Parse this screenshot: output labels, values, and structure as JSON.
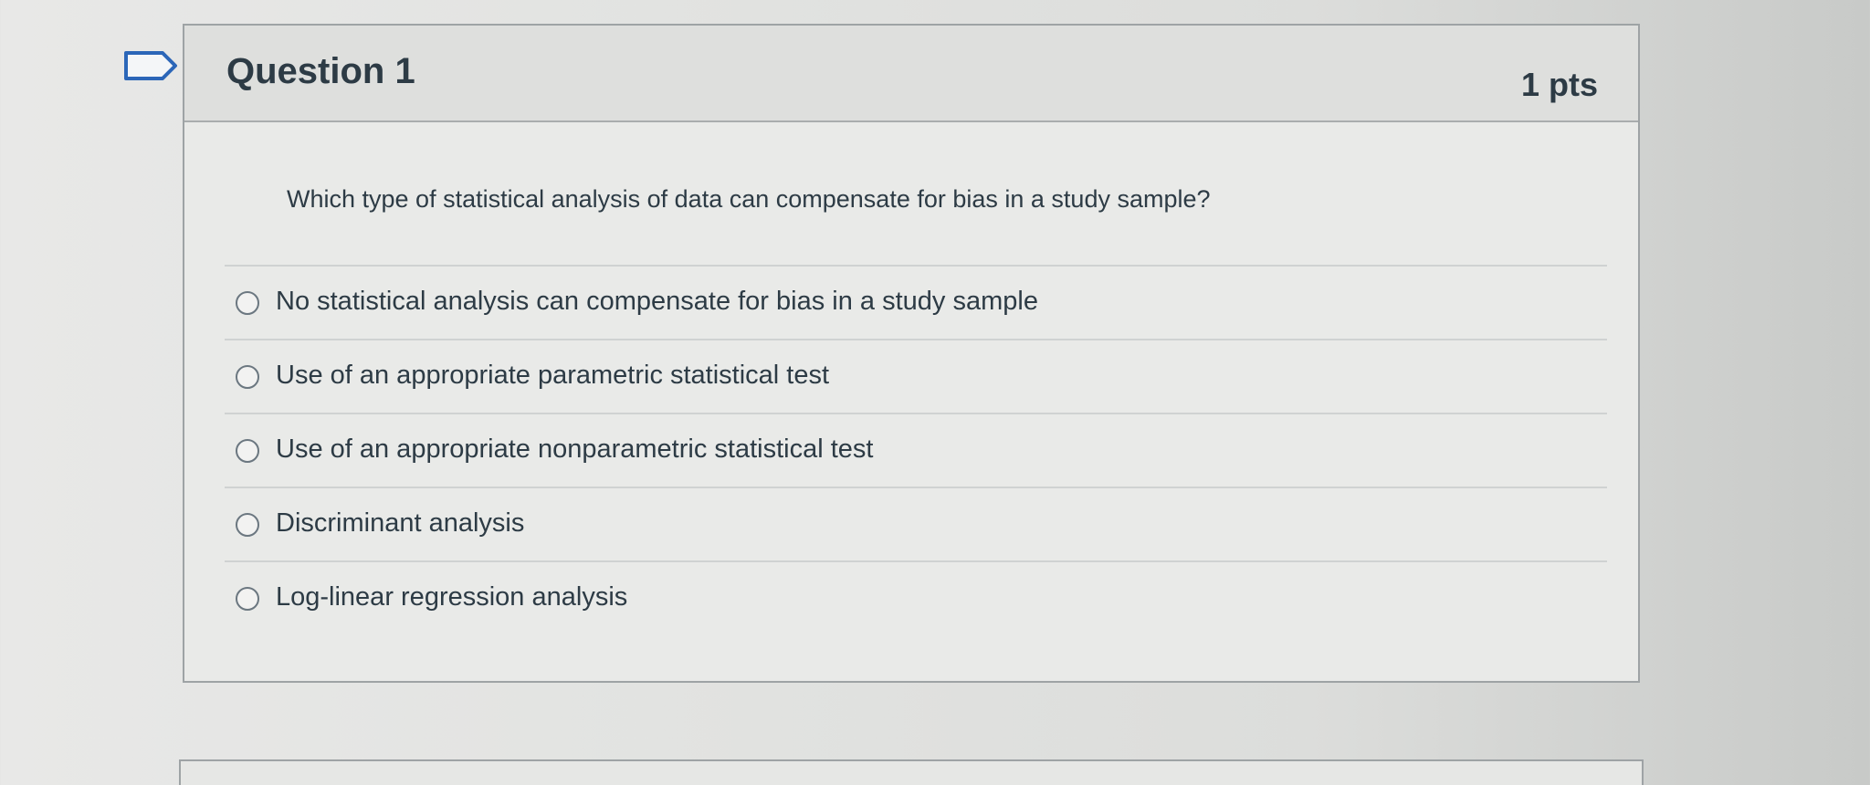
{
  "question": {
    "title": "Question 1",
    "points": "1 pts",
    "text": "Which type of statistical analysis of data can compensate for bias in a study sample?",
    "answers": [
      {
        "label": "No statistical analysis can compensate for bias in a study sample",
        "selected": false
      },
      {
        "label": "Use of an appropriate parametric statistical test",
        "selected": false
      },
      {
        "label": "Use of an appropriate nonparametric statistical test",
        "selected": false
      },
      {
        "label": "Discriminant analysis",
        "selected": false
      },
      {
        "label": "Log-linear regression analysis",
        "selected": false
      }
    ]
  },
  "icons": {
    "bookmark": "bookmark-flag-icon",
    "radio": "radio-button-unselected"
  },
  "colors": {
    "text": "#2d3b45",
    "bookmark_accent": "#2b66b8",
    "border": "#9ea3a5"
  }
}
